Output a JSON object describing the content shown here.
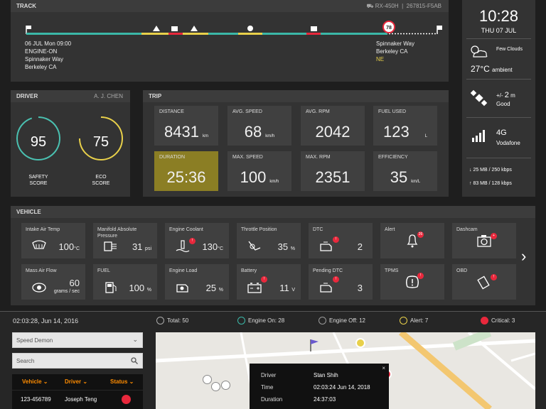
{
  "track": {
    "title": "TRACK",
    "vehicle_model": "RX-450h",
    "plate": "267815-F5AB",
    "start_date": "06 JUL Mon 09:00",
    "start_event": "ENGINE-ON",
    "start_street": "Spinnaker Way",
    "start_city": "Berkeley CA",
    "speed_marker": "78",
    "end_street": "Spinnaker Way",
    "end_city": "Berkeley CA",
    "end_direction": "NE"
  },
  "clock": {
    "time": "10:28",
    "date": "THU 07 JUL",
    "weather": "Few Clouds",
    "temp_value": "27",
    "temp_unit": "°C",
    "temp_label": "ambient",
    "gps_accuracy_prefix": "+/-",
    "gps_accuracy_value": "2",
    "gps_accuracy_unit": "m",
    "gps_quality": "Good",
    "network_type": "4G",
    "carrier": "Vodafone",
    "download": "25 MB / 250 kbps",
    "upload": "83 MB / 128 kbps"
  },
  "driver": {
    "title": "DRIVER",
    "name": "A. J. CHEN",
    "safety_score": 95,
    "safety_label_1": "SAFETY",
    "safety_label_2": "SCORE",
    "eco_score": 75,
    "eco_label_1": "ECO",
    "eco_label_2": "SCORE",
    "safety_color": "#4ac0b0",
    "eco_color": "#e8d04a"
  },
  "trip": {
    "title": "TRIP",
    "distance_label": "DISTANCE",
    "distance_value": "8431",
    "distance_unit": "km",
    "avg_speed_label": "AVG. SPEED",
    "avg_speed_value": "68",
    "avg_speed_unit": "km/h",
    "avg_rpm_label": "AVG. RPM",
    "avg_rpm_value": "2042",
    "fuel_label": "FUEL USED",
    "fuel_value": "123",
    "fuel_unit": "L",
    "duration_label": "DURATION",
    "duration_value": "25:36",
    "max_speed_label": "MAX. SPEED",
    "max_speed_value": "100",
    "max_speed_unit": "km/h",
    "max_rpm_label": "MAX. RPM",
    "max_rpm_value": "2351",
    "efficiency_label": "EFFICIENCY",
    "efficiency_value": "35",
    "efficiency_unit": "km/L"
  },
  "vehicle": {
    "title": "VEHICLE",
    "iat_label": "Intake Air Temp",
    "iat_value": "100",
    "iat_unit": "°C",
    "map_label": "Manifold Absolute Pressure",
    "map_value": "31",
    "map_unit": "psi",
    "coolant_label": "Engine Coolant",
    "coolant_value": "130",
    "coolant_unit": "°C",
    "throttle_label": "Throttle Position",
    "throttle_value": "35",
    "throttle_unit": "%",
    "dtc_label": "DTC",
    "dtc_value": "2",
    "dtc_badge": "!",
    "alert_label": "Alert",
    "alert_badge": "26",
    "dashcam_label": "Dashcam",
    "dashcam_badge": "+",
    "maf_label": "Mass Air Flow",
    "maf_value": "60",
    "maf_unit": "grams / sec",
    "fuel_label": "FUEL",
    "fuel_value": "100",
    "fuel_unit": "%",
    "load_label": "Engine Load",
    "load_value": "25",
    "load_unit": "%",
    "battery_label": "Battery",
    "battery_value": "11",
    "battery_unit": "V",
    "pdtc_label": "Pending DTC",
    "pdtc_value": "3",
    "tpms_label": "TPMS",
    "obd_label": "OBD",
    "next_arrow": "›"
  },
  "fleet": {
    "timestamp": "02:03:28, Jun 14, 2016",
    "total": "Total: 50",
    "engine_on": "Engine On: 28",
    "engine_off": "Engine Off: 12",
    "alert": "Alert: 7",
    "critical": "Critical: 3",
    "select_value": "Speed Demon",
    "search_placeholder": "Search",
    "col_vehicle": "Vehicle",
    "col_driver": "Driver",
    "col_status": "Status",
    "row_vehicle": "123-456789",
    "row_driver": "Joseph Teng",
    "popup_driver_label": "Driver",
    "popup_driver_value": "Stan Shih",
    "popup_time_label": "Time",
    "popup_time_value": "02:03:24 Jun 14, 2018",
    "popup_duration_label": "Duration",
    "popup_duration_value": "24:37:03"
  },
  "colors": {
    "accent_orange": "#ff8c00",
    "teal": "#3bb8a8",
    "yellow": "#e8d04a",
    "red": "#e8283c",
    "duration_bg": "#8b7e24"
  }
}
